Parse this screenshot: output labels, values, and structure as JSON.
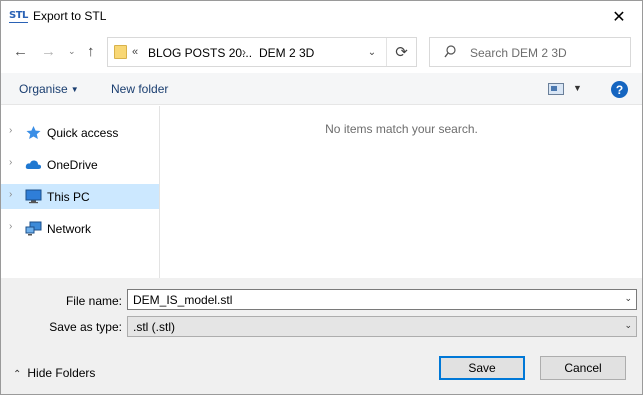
{
  "window": {
    "title": "Export to STL",
    "app_icon_text": "STL",
    "close_glyph": "✕"
  },
  "nav": {
    "back_glyph": "←",
    "forward_glyph": "→",
    "recent_glyph": "⌄",
    "up_glyph": "↑"
  },
  "address": {
    "overflow": "«",
    "crumbs": [
      "BLOG POSTS 20...",
      "DEM 2 3D"
    ],
    "separator": "›",
    "dropdown_glyph": "⌄",
    "refresh_glyph": "⟳"
  },
  "search": {
    "placeholder": "Search DEM 2 3D"
  },
  "toolbar": {
    "organise_label": "Organise",
    "new_folder_label": "New folder",
    "help_label": "?"
  },
  "sidebar": {
    "items": [
      {
        "label": "Quick access",
        "icon": "star-icon",
        "selected": false
      },
      {
        "label": "OneDrive",
        "icon": "cloud-icon",
        "selected": false
      },
      {
        "label": "This PC",
        "icon": "computer-icon",
        "selected": true
      },
      {
        "label": "Network",
        "icon": "network-icon",
        "selected": false
      }
    ]
  },
  "content": {
    "empty_message": "No items match your search."
  },
  "form": {
    "filename_label": "File name:",
    "filename_value": "DEM_IS_model.stl",
    "savetype_label": "Save as type:",
    "savetype_value": ".stl (.stl)"
  },
  "footer": {
    "hide_folders_label": "Hide Folders",
    "save_label": "Save",
    "cancel_label": "Cancel"
  },
  "colors": {
    "accent": "#0078d7",
    "selected_bg": "#cce8ff",
    "toolbar_bg": "#f5f6f7",
    "panel_bg": "#f0f0f0"
  }
}
